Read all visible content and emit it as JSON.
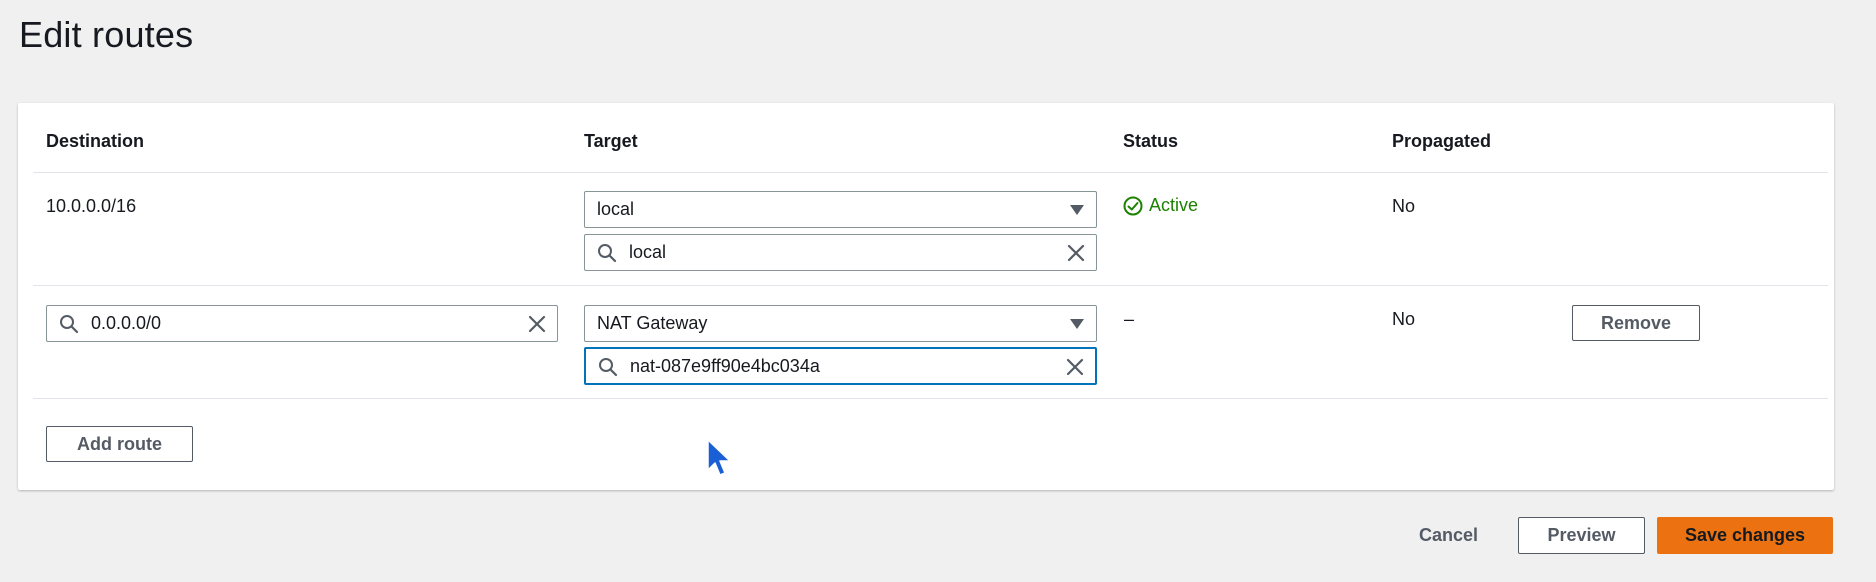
{
  "page": {
    "title": "Edit routes"
  },
  "table": {
    "headers": {
      "destination": "Destination",
      "target": "Target",
      "status": "Status",
      "propagated": "Propagated"
    },
    "rows": [
      {
        "destination": "10.0.0.0/16",
        "target_type": "local",
        "target_search": "local",
        "status": "Active",
        "propagated": "No"
      },
      {
        "destination": "0.0.0.0/0",
        "target_type": "NAT Gateway",
        "target_search": "nat-087e9ff90e4bc034a",
        "status": "–",
        "propagated": "No",
        "remove_label": "Remove"
      }
    ]
  },
  "actions": {
    "add_route": "Add route",
    "cancel": "Cancel",
    "preview": "Preview",
    "save": "Save changes"
  },
  "colors": {
    "primary": "#ec7211",
    "focus": "#0073bb",
    "success": "#1d8102",
    "cursor": "#1a5fd6"
  },
  "icons": [
    "search-icon",
    "clear-icon",
    "caret-down-icon",
    "check-circle-icon",
    "mouse-cursor-icon"
  ]
}
